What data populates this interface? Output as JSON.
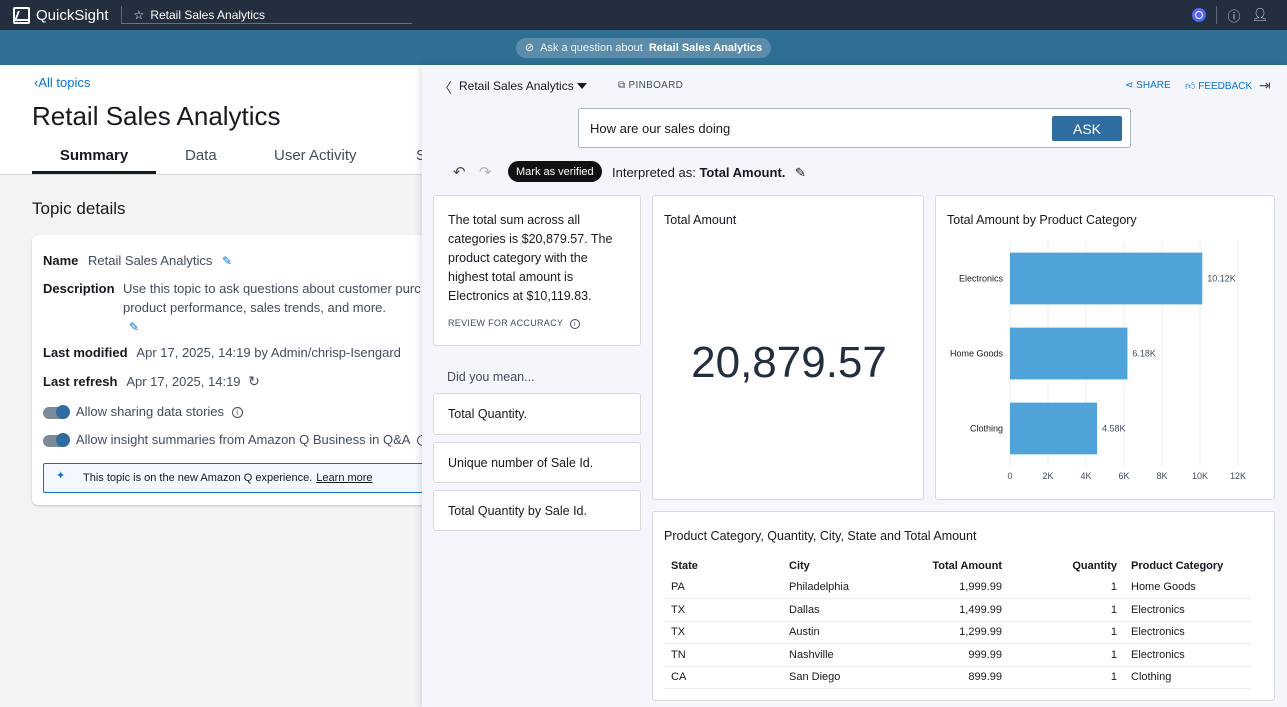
{
  "topbar": {
    "app_name": "QuickSight",
    "breadcrumb": "Retail Sales Analytics"
  },
  "askbar": {
    "prefix": "Ask a question about",
    "topic": "Retail Sales Analytics"
  },
  "left": {
    "back_label": "All topics",
    "title": "Retail Sales Analytics",
    "tabs": [
      "Summary",
      "Data",
      "User Activity",
      "S"
    ],
    "section_title": "Topic details",
    "name_label": "Name",
    "name_value": "Retail Sales Analytics",
    "description_label": "Description",
    "description_value": "Use this topic to ask questions about customer purc product performance, sales trends, and more.",
    "last_modified_label": "Last modified",
    "last_modified_value": "Apr 17, 2025, 14:19 by Admin/chrisp-Isengard",
    "last_refresh_label": "Last refresh",
    "last_refresh_value": "Apr 17, 2025, 14:19",
    "toggle1_label": "Allow sharing data stories",
    "toggle2_label": "Allow insight summaries from Amazon Q Business in Q&A",
    "notice_text": "This topic is on the new Amazon Q experience.",
    "notice_link": "Learn more"
  },
  "panel": {
    "topic_select": "Retail Sales Analytics",
    "pinboard_label": "PINBOARD",
    "share_label": "SHARE",
    "feedback_label": "FEEDBACK",
    "question_value": "How are our sales doing",
    "ask_label": "ASK",
    "verified_label": "Mark as verified",
    "interpreted_prefix": "Interpreted as:",
    "interpreted_value": "Total Amount.",
    "summary_text": "The total sum across all categories is $20,879.57. The product category with the highest total amount is Electronics at $10,119.83.",
    "review_label": "REVIEW FOR ACCURACY",
    "did_you_mean_label": "Did you mean...",
    "suggestions": [
      "Total Quantity.",
      "Unique number of Sale Id.",
      "Total Quantity by Sale Id."
    ],
    "kpi_title": "Total Amount",
    "kpi_value": "20,879.57",
    "table_title": "Product Category, Quantity, City, State and Total Amount",
    "table_headers": [
      "State",
      "City",
      "Total Amount",
      "Quantity",
      "Product Category"
    ],
    "table_rows": [
      [
        "PA",
        "Philadelphia",
        "1,999.99",
        "1",
        "Home Goods"
      ],
      [
        "TX",
        "Dallas",
        "1,499.99",
        "1",
        "Electronics"
      ],
      [
        "TX",
        "Austin",
        "1,299.99",
        "1",
        "Electronics"
      ],
      [
        "TN",
        "Nashville",
        "999.99",
        "1",
        "Electronics"
      ],
      [
        "CA",
        "San Diego",
        "899.99",
        "1",
        "Clothing"
      ]
    ]
  },
  "chart_data": {
    "type": "bar",
    "orientation": "horizontal",
    "title": "Total Amount by Product Category",
    "categories": [
      "Electronics",
      "Home Goods",
      "Clothing"
    ],
    "values": [
      10119.83,
      6180,
      4580
    ],
    "data_labels": [
      "10.12K",
      "6.18K",
      "4.58K"
    ],
    "xlim": [
      0,
      12000
    ],
    "x_ticks": [
      "0",
      "2K",
      "4K",
      "6K",
      "8K",
      "10K",
      "12K"
    ],
    "grid": true,
    "bar_color": "#4fa3d9"
  },
  "colors": {
    "topbar": "#232f3e",
    "askbar": "#2e6f93",
    "accent": "#2f6da0",
    "link": "#0972d3"
  }
}
